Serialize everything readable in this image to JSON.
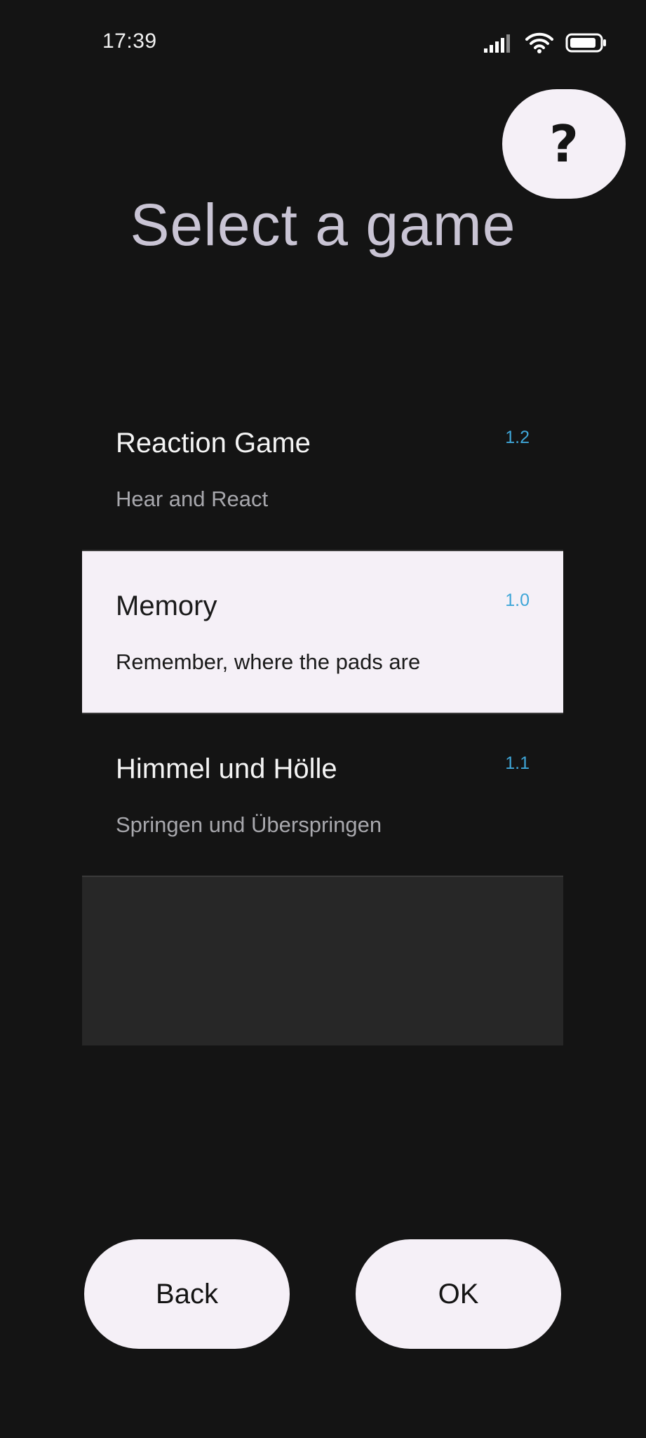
{
  "status_bar": {
    "time": "17:39",
    "icons": [
      "signal-icon",
      "wifi-icon",
      "battery-icon"
    ]
  },
  "help_button": {
    "label": "?"
  },
  "title": "Select a game",
  "games": [
    {
      "name": "Reaction Game",
      "description": "Hear and React",
      "version": "1.2",
      "selected": false
    },
    {
      "name": "Memory",
      "description": "Remember, where the pads are",
      "version": "1.0",
      "selected": true
    },
    {
      "name": "Himmel und Hölle",
      "description": "Springen und Überspringen",
      "version": "1.1",
      "selected": false
    }
  ],
  "buttons": {
    "back": "Back",
    "ok": "OK"
  },
  "colors": {
    "background": "#141414",
    "surface": "#f5f0f7",
    "version_accent": "#3fa6d8",
    "title": "#c9c4d4"
  }
}
